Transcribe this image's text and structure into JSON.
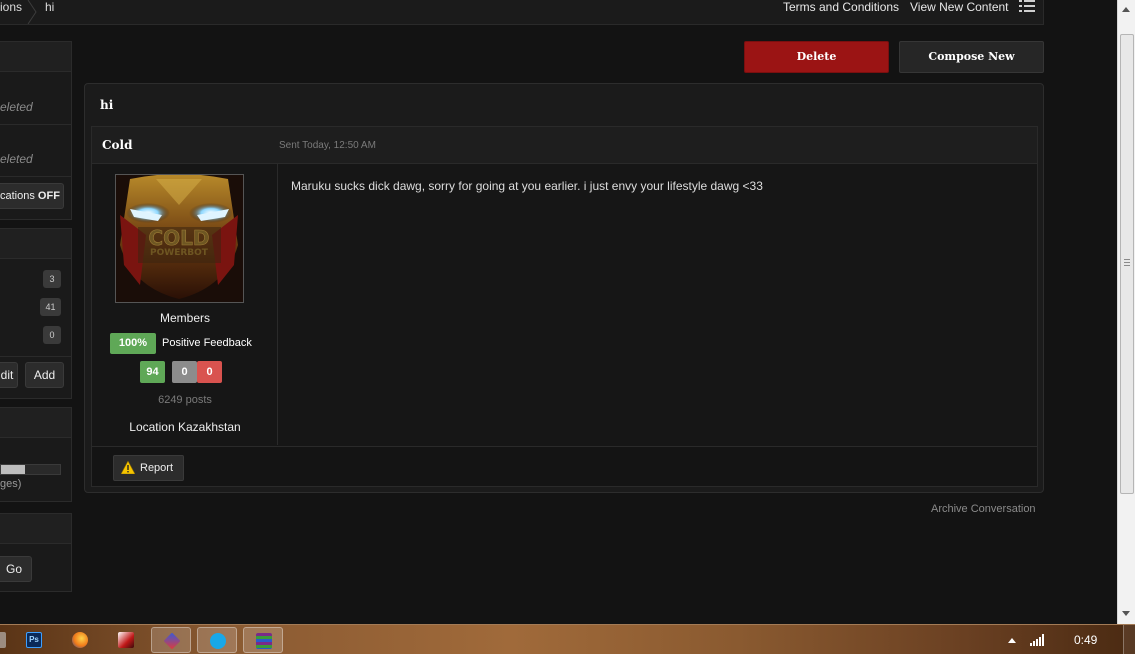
{
  "breadcrumb": {
    "parent": "ions",
    "current": "hi"
  },
  "top_links": {
    "terms": "Terms and Conditions",
    "view_new": "View New Content",
    "menu_icon": "list-icon"
  },
  "sidebar": {
    "deleted_1": "eleted",
    "deleted_2": "eleted",
    "notifications_prefix": "cations ",
    "notifications_state": "OFF",
    "counts": [
      "3",
      "41",
      "0"
    ],
    "edit_label": "dit",
    "add_label": "Add",
    "storage_text": "ges)",
    "storage_fraction": 0.4,
    "go_label": "Go"
  },
  "actions": {
    "delete": "Delete",
    "compose": "Compose New"
  },
  "conversation": {
    "title": "hi",
    "author": "Cold",
    "sent": "Sent Today, 12:50 AM",
    "avatar_text_1": "COLD",
    "avatar_text_2": "POWERBOT",
    "group": "Members",
    "feedback_percent": "100%",
    "feedback_label": "Positive Feedback",
    "rep_positive": "94",
    "rep_neutral": "0",
    "rep_negative": "0",
    "posts": "6249 posts",
    "location": "Location Kazakhstan",
    "message": "Maruku sucks dick dawg, sorry for going at you earlier. i just envy your lifestyle dawg <33",
    "report_label": "Report"
  },
  "archive_label": "Archive Conversation",
  "taskbar": {
    "time": "0:49",
    "photoshop_glyph": "Ps",
    "apps": [
      "windows-orb-icon",
      "photoshop-icon",
      "firefox-icon",
      "game-icon",
      "paint-icon",
      "skype-icon",
      "archive-icon"
    ]
  },
  "colors": {
    "delete_red": "#9b1414",
    "positive_green": "#5fa857",
    "negative_red": "#d9534f",
    "background": "#131313"
  }
}
